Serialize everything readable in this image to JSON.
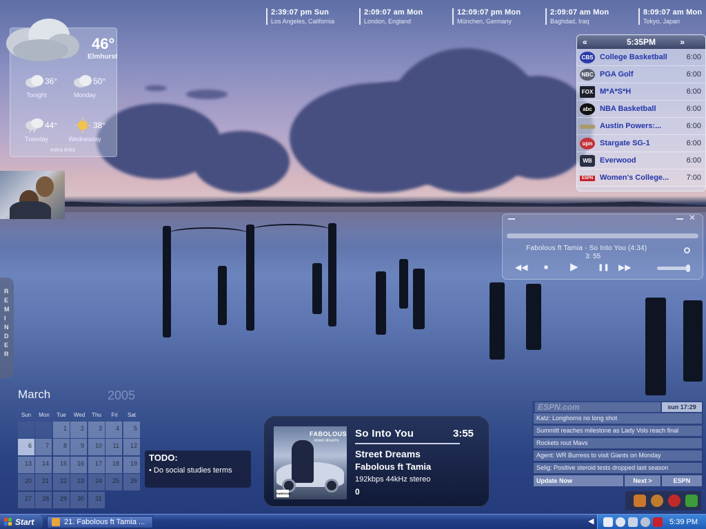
{
  "clocks": [
    {
      "time": "2:39:07 pm Sun",
      "city": "Los Angeles, California"
    },
    {
      "time": "2:09:07 am Mon",
      "city": "London, England"
    },
    {
      "time": "12:09:07 pm Mon",
      "city": "München, Germany"
    },
    {
      "time": "2:09:07 am Mon",
      "city": "Baghdad, Iraq"
    },
    {
      "time": "8:09:07 am Mon",
      "city": "Tokyo, Japan"
    }
  ],
  "weather": {
    "current_temp": "46°",
    "city": "Elmhurst",
    "forecast": [
      {
        "temp": "36°",
        "label": "Tonight"
      },
      {
        "temp": "50°",
        "label": "Monday"
      },
      {
        "temp": "44°",
        "label": "Tuesday"
      },
      {
        "temp": "38°",
        "label": "Wednesday"
      }
    ],
    "links": "extra links"
  },
  "reminder": {
    "label": "REMINDER"
  },
  "tv_guide": {
    "time": "5:35PM",
    "prev_icon": "arrow-left-icon",
    "next_icon": "arrow-right-icon",
    "rows": [
      {
        "logo": "CBS",
        "show": "College Basketball",
        "time": "6:00"
      },
      {
        "logo": "NBC",
        "show": "PGA Golf",
        "time": "6:00"
      },
      {
        "logo": "FOX",
        "show": "M*A*S*H",
        "time": "6:00"
      },
      {
        "logo": "abc",
        "show": "NBA Basketball",
        "time": "6:00"
      },
      {
        "logo": "",
        "show": "Austin Powers:...",
        "time": "6:00"
      },
      {
        "logo": "upn",
        "show": "Stargate SG-1",
        "time": "6:00"
      },
      {
        "logo": "WB",
        "show": "Everwood",
        "time": "6:00"
      },
      {
        "logo": "ESPN",
        "show": "Women's College...",
        "time": "7:00"
      }
    ]
  },
  "player": {
    "title": "Fabolous ft Tamia - So Into You (4:34)",
    "elapsed": "3: 55",
    "buttons": {
      "prev": "◀◀",
      "stop": "■",
      "play": "▶",
      "pause": "❚❚",
      "next": "▶▶"
    },
    "close": "✕"
  },
  "calendar": {
    "month": "March",
    "year": "2005",
    "weekdays": [
      "Sun",
      "Mon",
      "Tue",
      "Wed",
      "Thu",
      "Fri",
      "Sat"
    ],
    "days": [
      "1",
      "2",
      "3",
      "4",
      "5",
      "6",
      "7",
      "8",
      "9",
      "10",
      "11",
      "12",
      "13",
      "14",
      "15",
      "16",
      "17",
      "18",
      "19",
      "20",
      "21",
      "22",
      "23",
      "24",
      "25",
      "26",
      "27",
      "28",
      "29",
      "30",
      "31"
    ],
    "today": "6"
  },
  "todo": {
    "title": "TODO:",
    "items": [
      "• Do social studies terms"
    ]
  },
  "now_playing": {
    "song": "So Into You",
    "duration": "3:55",
    "album": "Street Dreams",
    "artist": "Fabolous ft Tamia",
    "quality": "192kbps 44kHz stereo",
    "count": "0",
    "cover_brand": "FABOLOUS",
    "cover_sub": "street dreams",
    "cover_badge": "PARENTAL ADVISORY"
  },
  "espn": {
    "logo": "ESPN.com",
    "date": "sun 17:29",
    "headlines": [
      "Katz: Longhorns no long shot",
      "Summitt reaches milestone as Lady Vols reach final",
      "Rockets rout Mavs",
      "Agent: WR Burress to visit Giants on Monday",
      "Selig: Positive steroid tests dropped last season"
    ],
    "update": "Update Now",
    "next": "Next >",
    "brand": "ESPN"
  },
  "taskbar": {
    "start": "Start",
    "task": "21. Fabolous ft Tamia ...",
    "clock": "5:39 PM"
  }
}
